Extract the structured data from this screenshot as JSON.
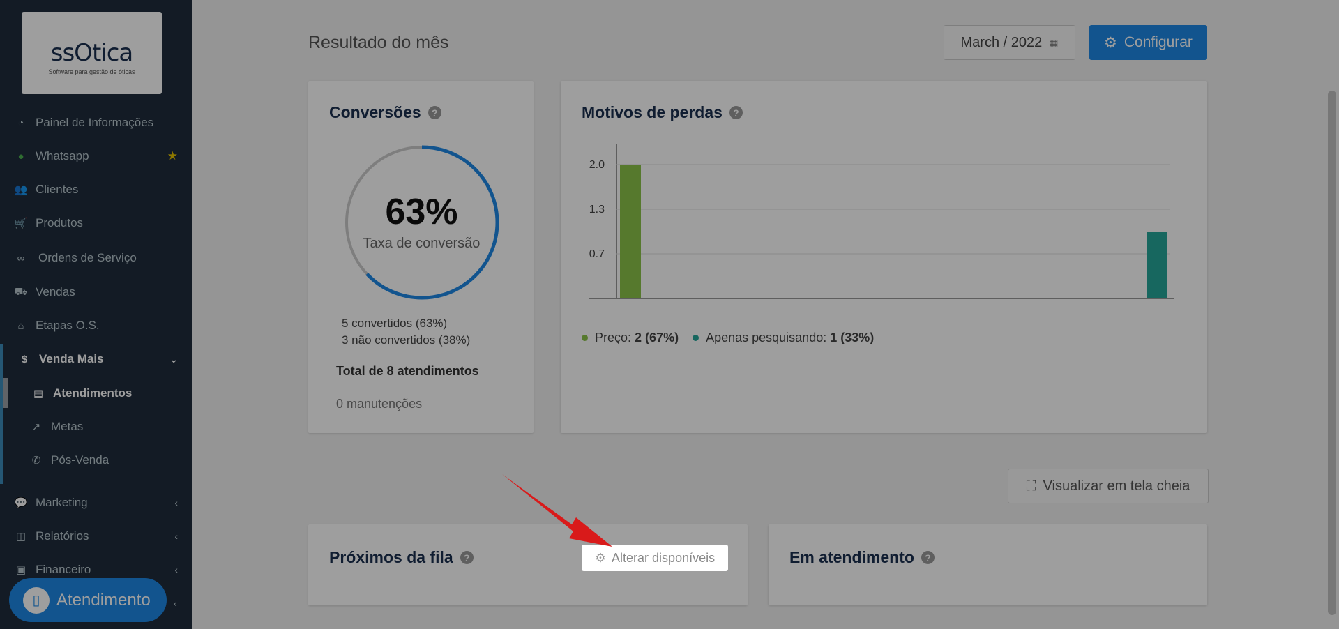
{
  "sidebar": {
    "logo_text": "ssOtica",
    "logo_sub": "Software para gestão de óticas",
    "items": [
      {
        "label": "Painel de Informações",
        "icon": "dashboard-icon"
      },
      {
        "label": "Whatsapp",
        "icon": "whatsapp-icon"
      },
      {
        "label": "Clientes",
        "icon": "users-icon"
      },
      {
        "label": "Produtos",
        "icon": "cart-icon"
      },
      {
        "label": "Ordens de Serviço",
        "icon": "glasses-icon"
      },
      {
        "label": "Vendas",
        "icon": "basket-icon"
      },
      {
        "label": "Etapas O.S.",
        "icon": "tag-icon"
      },
      {
        "label": "Venda Mais",
        "icon": "dollar-icon"
      },
      {
        "label": "Atendimentos",
        "icon": "clipboard-icon"
      },
      {
        "label": "Metas",
        "icon": "chart-icon"
      },
      {
        "label": "Pós-Venda",
        "icon": "phone-icon"
      },
      {
        "label": "Marketing",
        "icon": "comments-icon"
      },
      {
        "label": "Relatórios",
        "icon": "report-icon"
      },
      {
        "label": "Financeiro",
        "icon": "money-icon"
      }
    ],
    "atendimento_button": "Atendimento"
  },
  "header": {
    "title": "Resultado do mês",
    "date": "March / 2022",
    "config_label": "Configurar"
  },
  "conversoes": {
    "title": "Conversões",
    "percent": "63%",
    "percent_value": 63,
    "label": "Taxa de conversão",
    "convertidos": "5 convertidos (63%)",
    "nao_convertidos": "3 não convertidos (38%)",
    "total": "Total de 8 atendimentos",
    "manutencoes": "0 manutenções"
  },
  "motivos": {
    "title": "Motivos de perdas",
    "legend": [
      {
        "name": "Preço:",
        "value": "2 (67%)",
        "color": "#8bc34a"
      },
      {
        "name": "Apenas pesquisando:",
        "value": "1 (33%)",
        "color": "#26a69a"
      }
    ]
  },
  "chart_data": {
    "type": "bar",
    "categories": [
      "Preço",
      "Apenas pesquisando"
    ],
    "values": [
      2,
      1
    ],
    "ytick_labels": [
      "2.0",
      "1.3",
      "0.7"
    ],
    "ylim": [
      0,
      2.0
    ],
    "colors": [
      "#8bc34a",
      "#26a69a"
    ],
    "grid": true
  },
  "fullscreen_label": "Visualizar em tela cheia",
  "proximos": {
    "title": "Próximos da fila",
    "alterar_label": "Alterar disponíveis"
  },
  "em_atendimento": {
    "title": "Em atendimento"
  }
}
